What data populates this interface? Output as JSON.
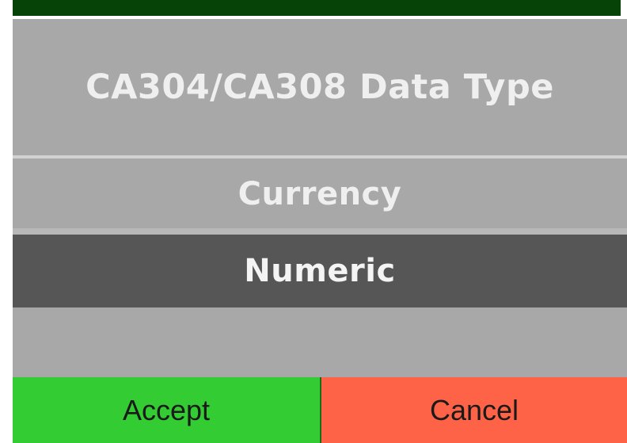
{
  "dialog": {
    "title": "CA304/CA308 Data Type",
    "options": [
      {
        "label": "Currency",
        "selected": false
      },
      {
        "label": "Numeric",
        "selected": true
      }
    ],
    "buttons": {
      "accept_label": "Accept",
      "cancel_label": "Cancel"
    },
    "colors": {
      "header_bar": "#064306",
      "panel": "#a8a8a8",
      "selected_row": "#565656",
      "accept": "#33cc33",
      "cancel": "#ff6347"
    }
  }
}
